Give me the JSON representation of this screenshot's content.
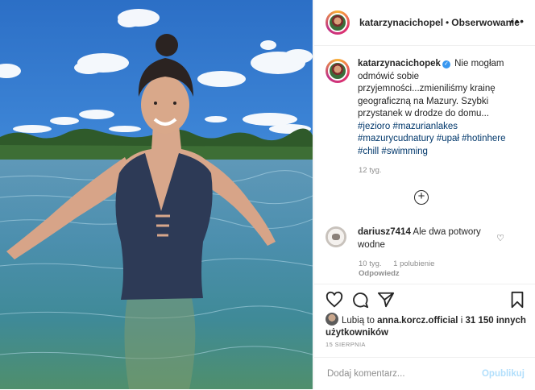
{
  "post": {
    "author": "katarzynacichopel",
    "follow_label": "Obserwowanie",
    "more_label": "•••"
  },
  "caption": {
    "username": "katarzynacichopek",
    "verified_mark": "✓",
    "text": "Nie mogłam odmówić sobie przyjemności...zmieniliśmy krainę geograficzną na Mazury. Szybki przystanek w drodze do domu...",
    "hashtags": [
      "#jezioro",
      "#mazurianlakes",
      "#mazurycudnatury",
      "#upał",
      "#hotinhere",
      "#chill",
      "#swimming"
    ],
    "time": "12 tyg."
  },
  "more_comments_label": "+",
  "comment": {
    "username": "dariusz7414",
    "text": "Ale dwa potwory wodne",
    "time": "10 tyg.",
    "likes": "1 polubienie",
    "reply_label": "Odpowiedz",
    "heart_icon": "♡"
  },
  "likes": {
    "prefix": "Lubią to",
    "user": "anna.korcz.official",
    "connector": "i",
    "others": "31 150 innych użytkowników"
  },
  "date": "15 SIERPNIA",
  "add_comment": {
    "placeholder": "Dodaj komentarz...",
    "publish_label": "Opublikuj"
  },
  "icons": {
    "like": "heart-icon",
    "comment": "comment-icon",
    "share": "share-icon",
    "save": "bookmark-icon"
  }
}
